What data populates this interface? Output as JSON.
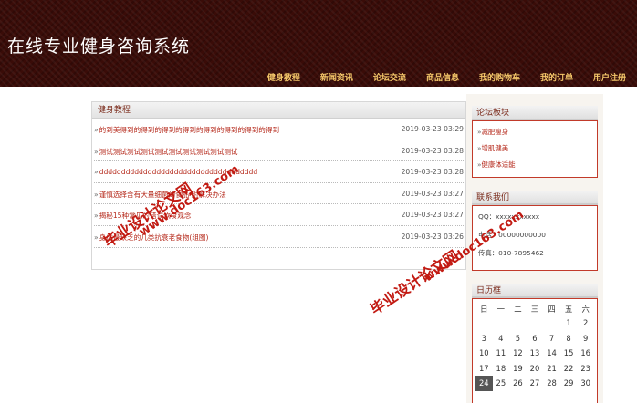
{
  "header": {
    "site_title": "在线专业健身咨询系统"
  },
  "nav": [
    "健身教程",
    "新闻资讯",
    "论坛交流",
    "商品信息",
    "我的购物车",
    "我的订单",
    "用户注册"
  ],
  "main": {
    "heading": "健身教程",
    "items": [
      {
        "title": "的到美得到的得到的得到的得到的得到的得到的得到的得到",
        "date": "2019-03-23 03:29"
      },
      {
        "title": "测试测试测试测试测试测试测试测试测试测试",
        "date": "2019-03-23 03:28"
      },
      {
        "title": "dddddddddddddddddddddddddddddddddddd",
        "date": "2019-03-23 03:28"
      },
      {
        "title": "谨慎选择含有大量细菌的食品 附解决办法",
        "date": "2019-03-23 03:27"
      },
      {
        "title": "揭秘15种常见的错误饮食观念",
        "date": "2019-03-23 03:27"
      },
      {
        "title": "身体最缺乏的几类抗衰老食物(组图)",
        "date": "2019-03-23 03:26"
      }
    ]
  },
  "forum": {
    "heading": "论坛板块",
    "items": [
      "减肥瘦身",
      "增肌健美",
      "健康体适能"
    ]
  },
  "contact": {
    "heading": "联系我们",
    "lines": [
      "QQ：xxxxxxxxxxx",
      "电话：00000000000",
      "传真：010-7895462"
    ]
  },
  "calendar": {
    "heading": "日历框",
    "weekdays": [
      "日",
      "一",
      "二",
      "三",
      "四",
      "五",
      "六"
    ],
    "weeks": [
      [
        "",
        "",
        "",
        "",
        "",
        "1",
        "2"
      ],
      [
        "3",
        "4",
        "5",
        "6",
        "7",
        "8",
        "9"
      ],
      [
        "10",
        "11",
        "12",
        "13",
        "14",
        "15",
        "16"
      ],
      [
        "17",
        "18",
        "19",
        "20",
        "21",
        "22",
        "23"
      ],
      [
        "24",
        "25",
        "26",
        "27",
        "28",
        "29",
        "30"
      ]
    ],
    "today": "24"
  },
  "watermarks": [
    "毕业设计论文网",
    "www.doc163.com",
    "毕业设计论文网",
    "www.doc163.com"
  ]
}
